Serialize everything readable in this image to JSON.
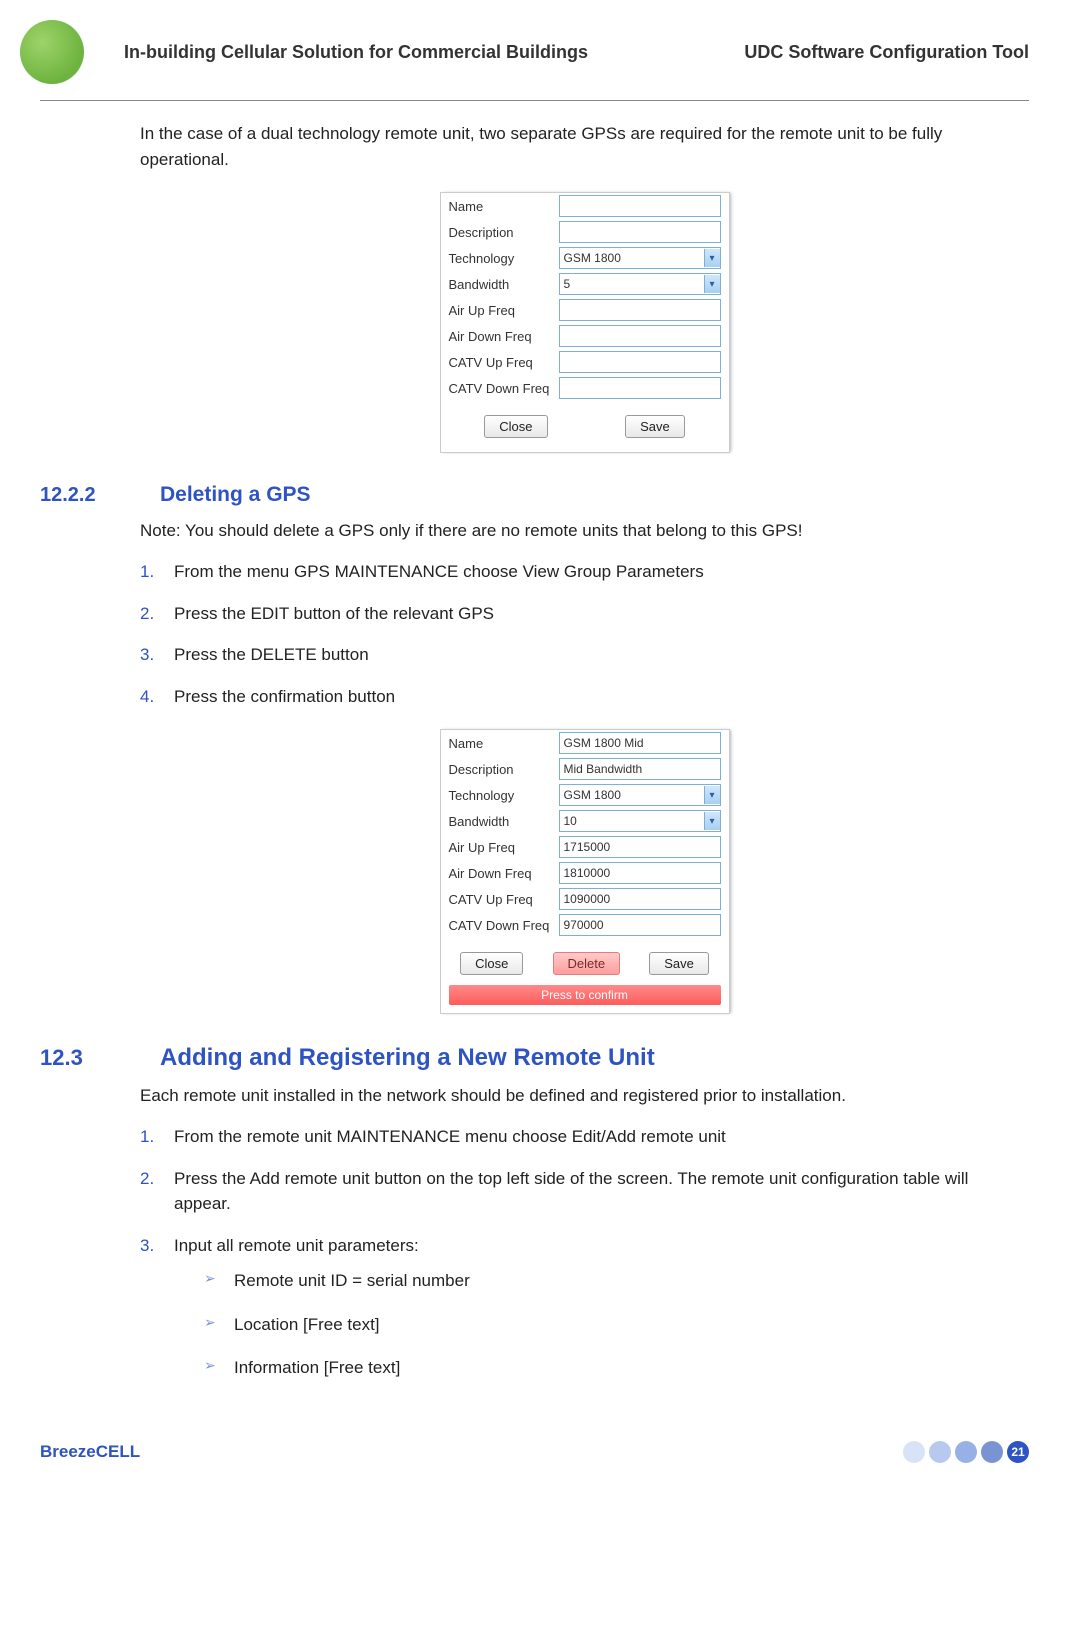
{
  "header": {
    "left": "In-building Cellular Solution for Commercial Buildings",
    "right": "UDC Software Configuration Tool"
  },
  "intro": "In the case of a dual technology remote unit, two separate GPSs are required for the remote unit to be fully operational.",
  "form1": {
    "fields": {
      "name_label": "Name",
      "name_value": "",
      "desc_label": "Description",
      "desc_value": "",
      "tech_label": "Technology",
      "tech_value": "GSM 1800",
      "bw_label": "Bandwidth",
      "bw_value": "5",
      "airup_label": "Air Up Freq",
      "airup_value": "",
      "airdown_label": "Air Down Freq",
      "airdown_value": "",
      "catvup_label": "CATV Up Freq",
      "catvup_value": "",
      "catvdown_label": "CATV Down Freq",
      "catvdown_value": ""
    },
    "buttons": {
      "close": "Close",
      "save": "Save"
    }
  },
  "sec1222": {
    "num": "12.2.2",
    "title": "Deleting a GPS",
    "note": "Note: You should delete a GPS only if there are no remote units that belong to this GPS!",
    "steps": [
      "From the menu GPS MAINTENANCE choose View Group Parameters",
      "Press the EDIT button of the relevant GPS",
      "Press the DELETE button",
      "Press the confirmation button"
    ]
  },
  "form2": {
    "fields": {
      "name_label": "Name",
      "name_value": "GSM 1800 Mid",
      "desc_label": "Description",
      "desc_value": "Mid Bandwidth",
      "tech_label": "Technology",
      "tech_value": "GSM 1800",
      "bw_label": "Bandwidth",
      "bw_value": "10",
      "airup_label": "Air Up Freq",
      "airup_value": "1715000",
      "airdown_label": "Air Down Freq",
      "airdown_value": "1810000",
      "catvup_label": "CATV Up Freq",
      "catvup_value": "1090000",
      "catvdown_label": "CATV Down Freq",
      "catvdown_value": "970000"
    },
    "buttons": {
      "close": "Close",
      "delete": "Delete",
      "save": "Save"
    },
    "confirm": "Press to confirm"
  },
  "sec123": {
    "num": "12.3",
    "title": "Adding and Registering a New Remote Unit",
    "intro": "Each remote unit installed in the network should be defined and registered prior to installation.",
    "steps": [
      "From the remote unit MAINTENANCE menu choose Edit/Add remote unit",
      "Press the Add remote unit button on the top left side of the screen. The remote unit configuration table will appear.",
      "Input all remote unit parameters:"
    ],
    "bullets": [
      "Remote unit ID = serial number",
      "Location [Free text]",
      "Information [Free text]"
    ]
  },
  "footer": {
    "brand": "BreezeCELL",
    "page": "21"
  }
}
